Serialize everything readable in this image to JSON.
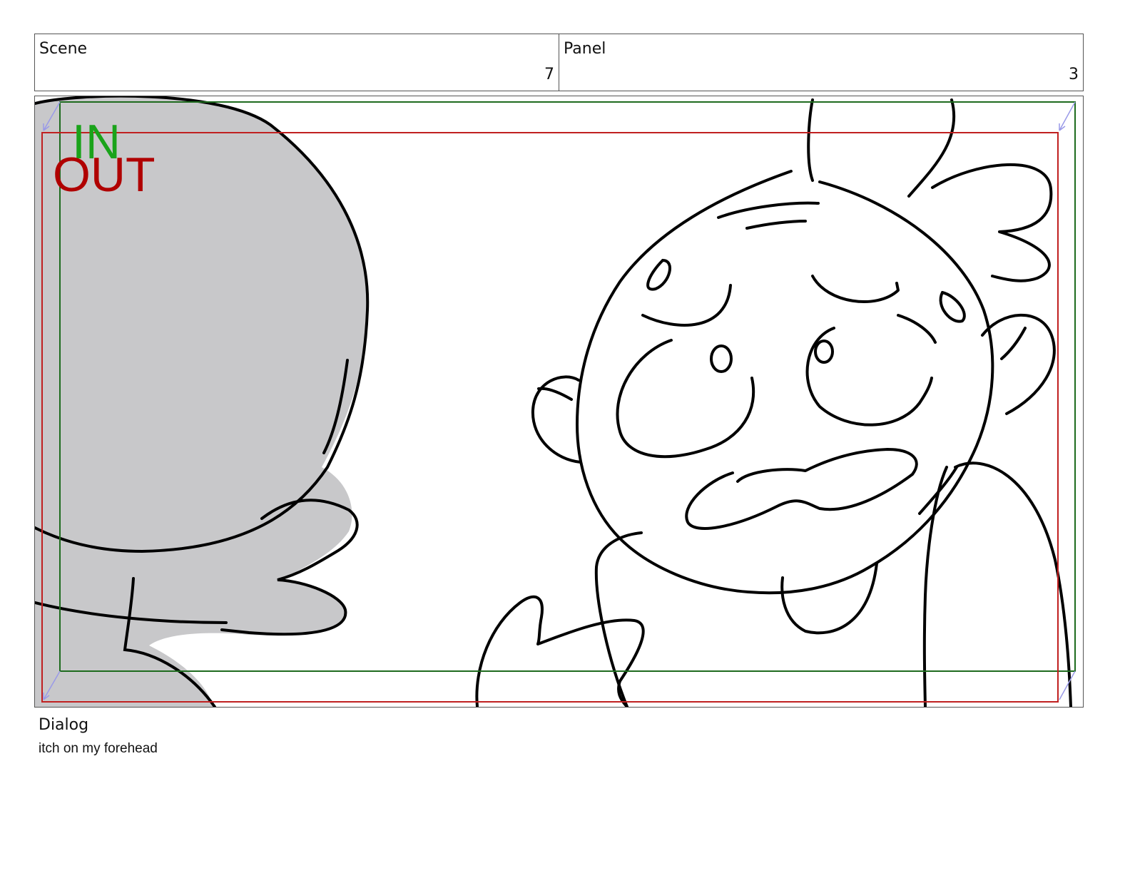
{
  "header": {
    "scene_label": "Scene",
    "scene_value": "7",
    "panel_label": "Panel",
    "panel_value": "3"
  },
  "frame": {
    "in_label": "IN",
    "out_label": "OUT",
    "in_color": "#1aa31a",
    "out_color": "#b00000"
  },
  "dialog": {
    "label": "Dialog",
    "text": "itch on my forehead"
  }
}
